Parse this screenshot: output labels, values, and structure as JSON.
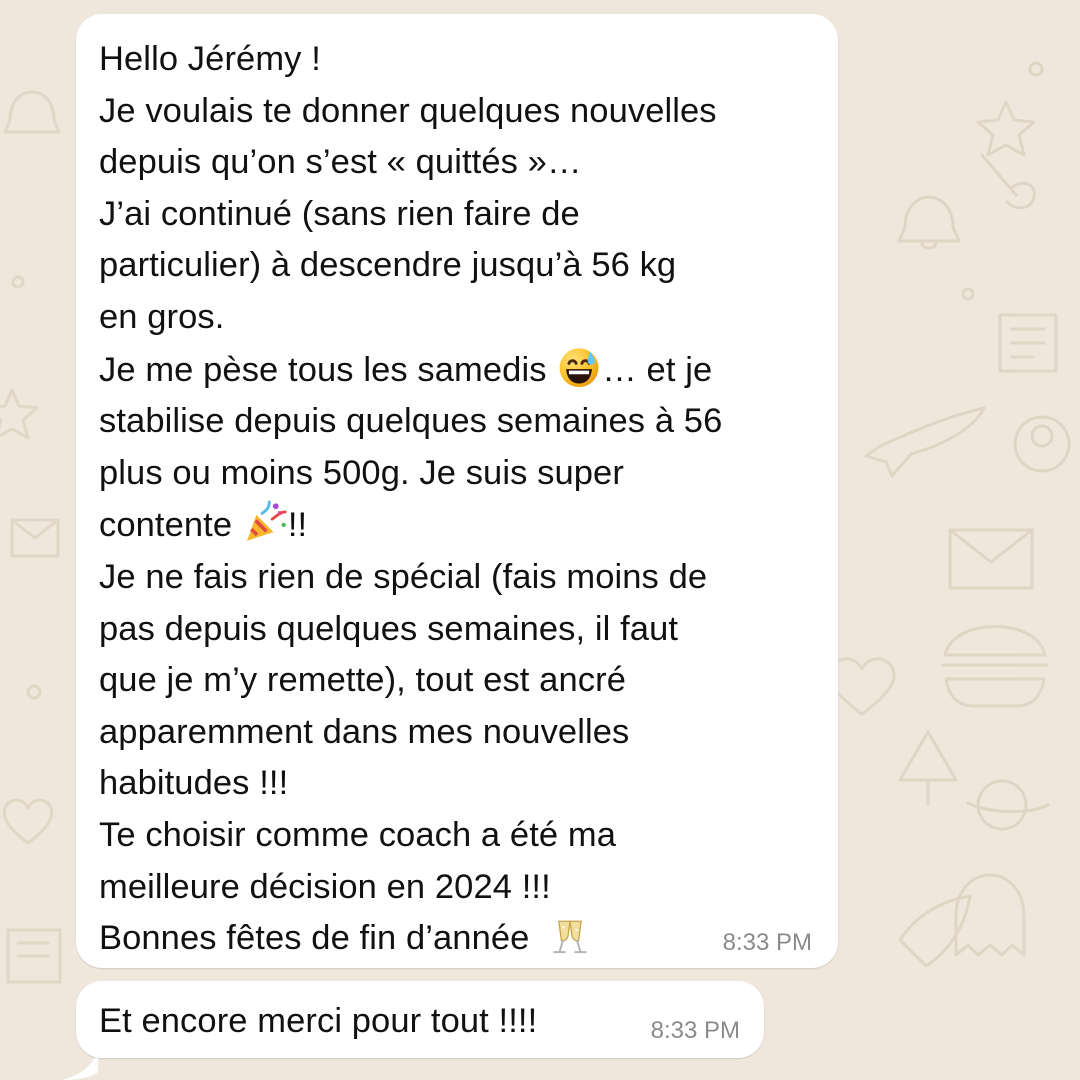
{
  "chat": {
    "messages": [
      {
        "lines": [
          "Hello Jérémy !",
          "Je voulais te donner quelques nouvelles",
          "depuis qu’on s’est « quittés »…",
          "J’ai continué (sans rien faire de",
          "particulier) à descendre jusqu’à 56 kg",
          "en gros.",
          "Je me pèse tous les samedis",
          "… et je",
          "stabilise depuis quelques semaines à 56",
          "plus ou moins 500g. Je suis super",
          "contente",
          "!!",
          "Je ne fais rien de spécial (fais moins de",
          "pas depuis quelques semaines, il faut",
          "que je m’y remette), tout est ancré",
          "apparemment dans mes nouvelles",
          "habitudes !!!",
          "Te choisir comme coach a été ma",
          "meilleure décision en 2024 !!!",
          "Bonnes fêtes de fin d’année"
        ],
        "emojis": [
          "grinning-sweat-emoji",
          "party-popper-emoji",
          "champagne-glasses-emoji"
        ],
        "time": "8:33 PM"
      },
      {
        "text": "Et encore merci pour tout !!!!",
        "time": "8:33 PM"
      }
    ]
  },
  "colors": {
    "wallpaper": "#efe7dc",
    "bubble": "#ffffff",
    "text": "#111111",
    "timestamp": "#8b8b8b"
  }
}
